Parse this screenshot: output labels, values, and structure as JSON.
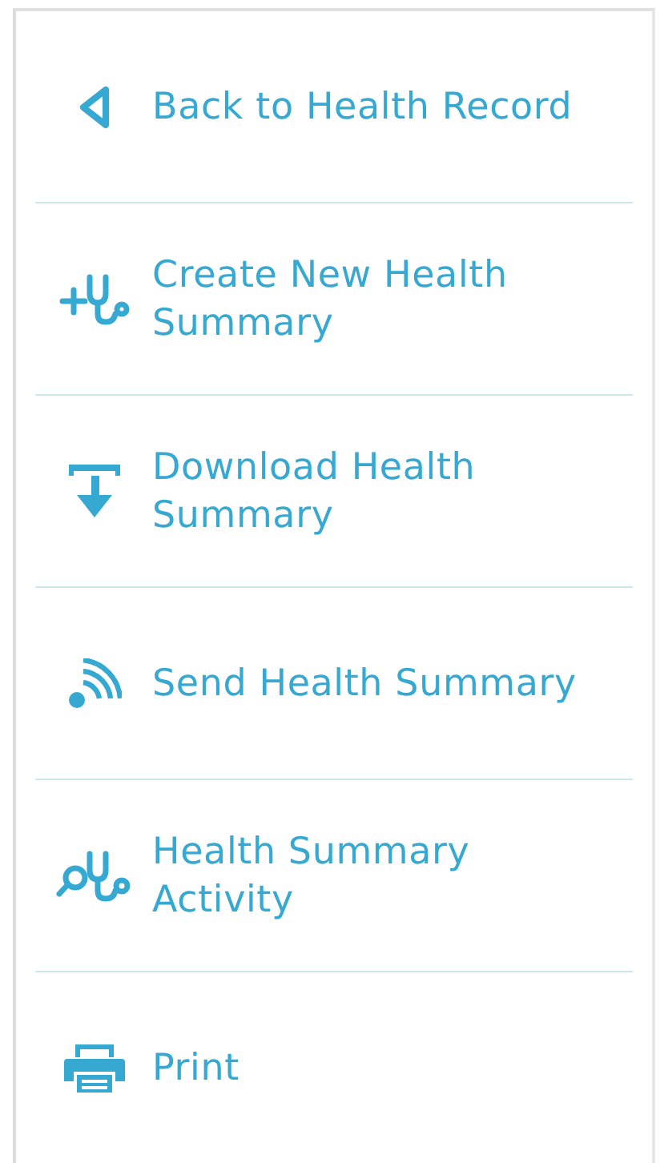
{
  "menu": {
    "items": [
      {
        "kind": "back",
        "label": "Back to Health Record"
      },
      {
        "kind": "create",
        "label": "Create New Health Summary"
      },
      {
        "kind": "download",
        "label": "Download Health Summary"
      },
      {
        "kind": "send",
        "label": "Send Health Summary"
      },
      {
        "kind": "activity",
        "label": "Health Summary Activity"
      },
      {
        "kind": "print",
        "label": "Print"
      }
    ]
  }
}
